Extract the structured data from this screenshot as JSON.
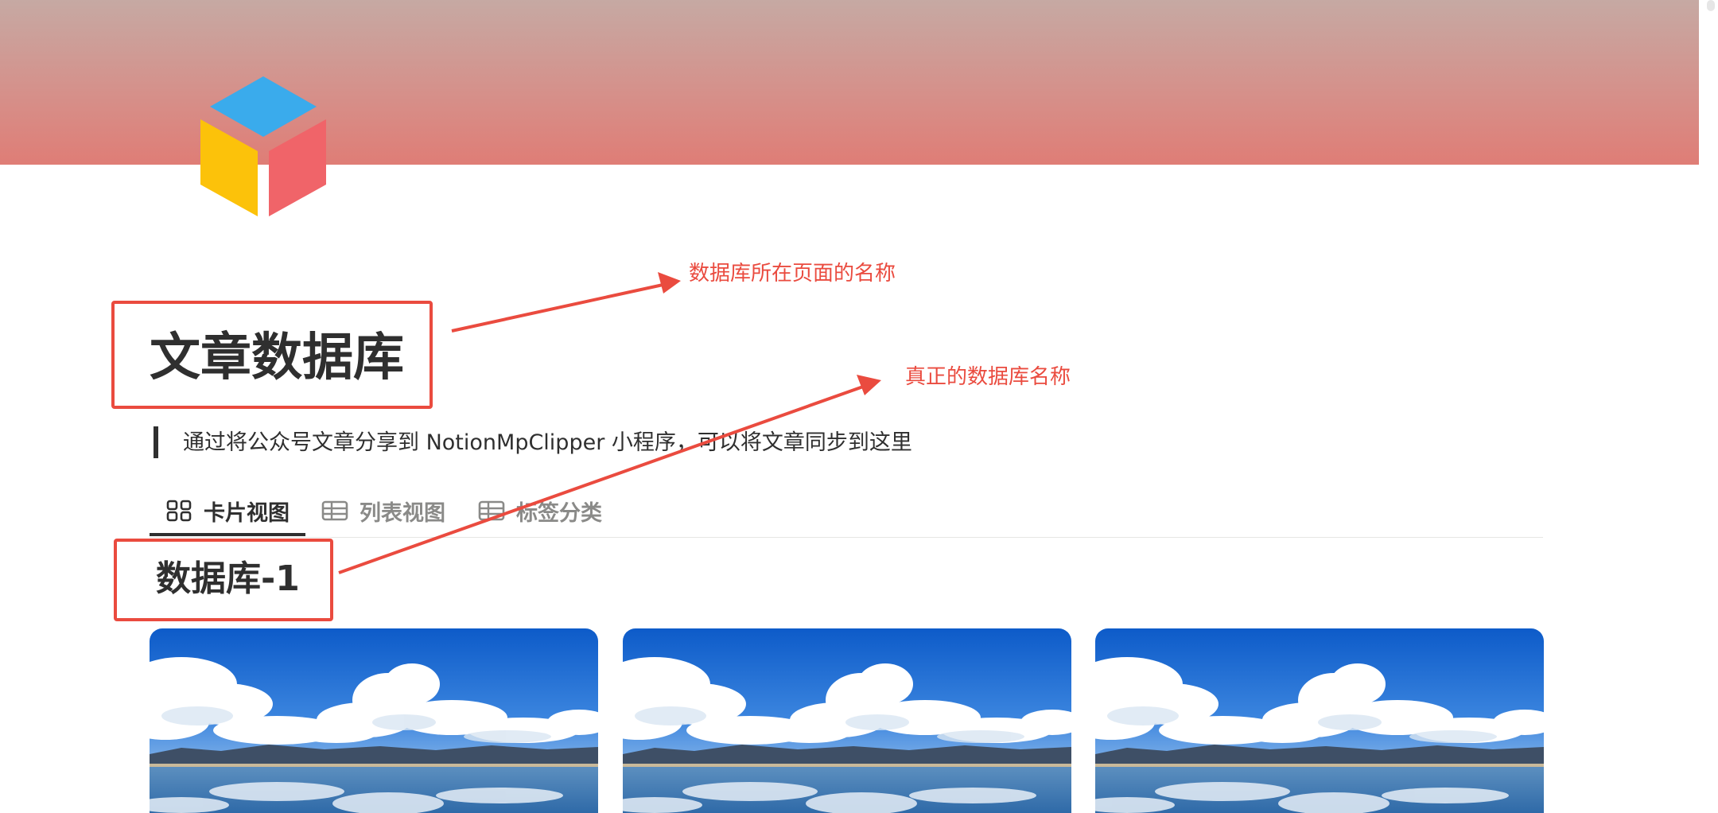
{
  "page": {
    "title": "文章数据库",
    "description": "通过将公众号文章分享到 NotionMpClipper 小程序，可以将文章同步到这里"
  },
  "tabs": [
    {
      "label": "卡片视图",
      "icon": "gallery-grid-icon",
      "active": true
    },
    {
      "label": "列表视图",
      "icon": "table-icon",
      "active": false
    },
    {
      "label": "标签分类",
      "icon": "table-icon",
      "active": false
    }
  ],
  "database": {
    "title": "数据库-1"
  },
  "annotations": {
    "page_name": "数据库所在页面的名称",
    "db_name": "真正的数据库名称"
  },
  "colors": {
    "annotation": "#ea4b3f",
    "cover_top": "#c6a9a3",
    "cover_bottom": "#df7d76",
    "icon_top": "#3aabec",
    "icon_left": "#fcc20a",
    "icon_right": "#f06469"
  },
  "cards": [
    {
      "image": "lake-landscape-thumbnail"
    },
    {
      "image": "lake-landscape-thumbnail"
    },
    {
      "image": "lake-landscape-thumbnail"
    }
  ]
}
